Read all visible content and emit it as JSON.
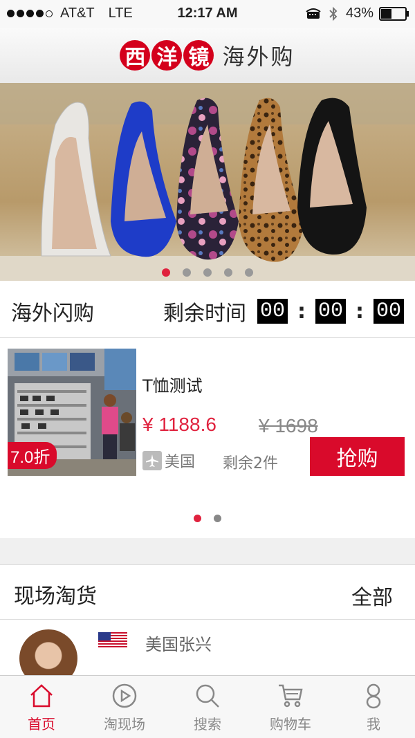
{
  "status_bar": {
    "carrier": "AT&T",
    "network": "LTE",
    "time": "12:17 AM",
    "battery": "43%",
    "battery_level": 0.43
  },
  "header": {
    "logo_characters": [
      "西",
      "洋",
      "镜"
    ],
    "logo_subtitle": "海外购",
    "brand_color": "#d4001c"
  },
  "banner": {
    "slide_count": 5,
    "active_index": 0
  },
  "flash_sale": {
    "title": "海外闪购",
    "remaining_label": "剩余时间",
    "hours": "00",
    "minutes": "00",
    "seconds": "00"
  },
  "product": {
    "name": "T恤测试",
    "price": "¥ 1188.6",
    "original_price": "¥ 1698",
    "discount": "7.0折",
    "origin": "美国",
    "stock": "剩余2件",
    "buy_label": "抢购",
    "page_count": 2,
    "active_page": 0
  },
  "live": {
    "title": "现场淘货",
    "all_label": "全部",
    "seller_name": "美国张兴"
  },
  "tabs": [
    {
      "label": "首页",
      "icon": "home-icon",
      "active": true
    },
    {
      "label": "淘现场",
      "icon": "play-icon",
      "active": false
    },
    {
      "label": "搜索",
      "icon": "search-icon",
      "active": false
    },
    {
      "label": "购物车",
      "icon": "cart-icon",
      "active": false
    },
    {
      "label": "我",
      "icon": "user-icon",
      "active": false
    }
  ],
  "colors": {
    "accent": "#d90a2b",
    "price": "#e0223e"
  }
}
